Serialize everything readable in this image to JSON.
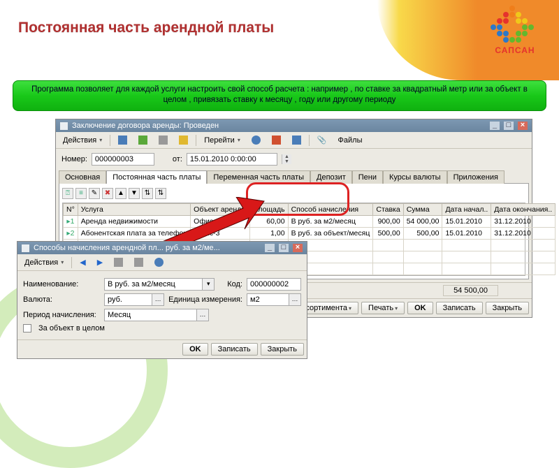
{
  "slide": {
    "title": "Постоянная часть арендной платы",
    "banner": "Программа позволяет для каждой услуги настроить свой способ расчета : например , по ставке за квадратный метр или за объект в целом , привязать ставку к месяцу , году или другому периоду",
    "logo_caption": "САПСАН"
  },
  "main_window": {
    "title": "Заключение договора аренды: Проведен",
    "toolbar": {
      "actions": "Действия",
      "goto": "Перейти",
      "files": "Файлы"
    },
    "form": {
      "number_label": "Номер:",
      "number_value": "000000003",
      "from_label": "от:",
      "date_value": "15.01.2010 0:00:00"
    },
    "tabs": [
      "Основная",
      "Постоянная часть платы",
      "Переменная часть платы",
      "Депозит",
      "Пени",
      "Курсы валюты",
      "Приложения"
    ],
    "active_tab_index": 1,
    "grid": {
      "headers": [
        "N°",
        "Услуга",
        "Объект аренды",
        "Площадь",
        "Способ начисления",
        "Ставка",
        "Сумма",
        "Дата начал..",
        "Дата окончания.."
      ],
      "rows": [
        {
          "n": "1",
          "service": "Аренда недвижимости",
          "obj": "Офис-3",
          "area": "60,00",
          "method": "В руб. за м2/месяц",
          "rate": "900,00",
          "sum": "54 000,00",
          "start": "15.01.2010",
          "end": "31.12.2010"
        },
        {
          "n": "2",
          "service": "Абонентская плата за телефон",
          "obj": "Офис-3",
          "area": "1,00",
          "method": "В руб. за объект/месяц",
          "rate": "500,00",
          "sum": "500,00",
          "start": "15.01.2010",
          "end": "31.12.2010"
        }
      ]
    },
    "total": "54 500,00",
    "footer": {
      "struct": "Структура ассортимента",
      "print": "Печать",
      "ok": "OK",
      "save": "Записать",
      "close": "Закрыть"
    }
  },
  "sub_window": {
    "title": "Способы начисления арендной пл...      руб. за м2/ме...",
    "toolbar_actions": "Действия",
    "fields": {
      "name_label": "Наименование:",
      "name_value": "В руб. за м2/месяц",
      "code_label": "Код:",
      "code_value": "000000002",
      "currency_label": "Валюта:",
      "currency_value": "руб.",
      "unit_label": "Единица измерения:",
      "unit_value": "м2",
      "period_label": "Период начисления:",
      "period_value": "Месяц",
      "whole_obj_label": "За объект в целом"
    },
    "buttons": {
      "ok": "OK",
      "save": "Записать",
      "close": "Закрыть"
    }
  }
}
